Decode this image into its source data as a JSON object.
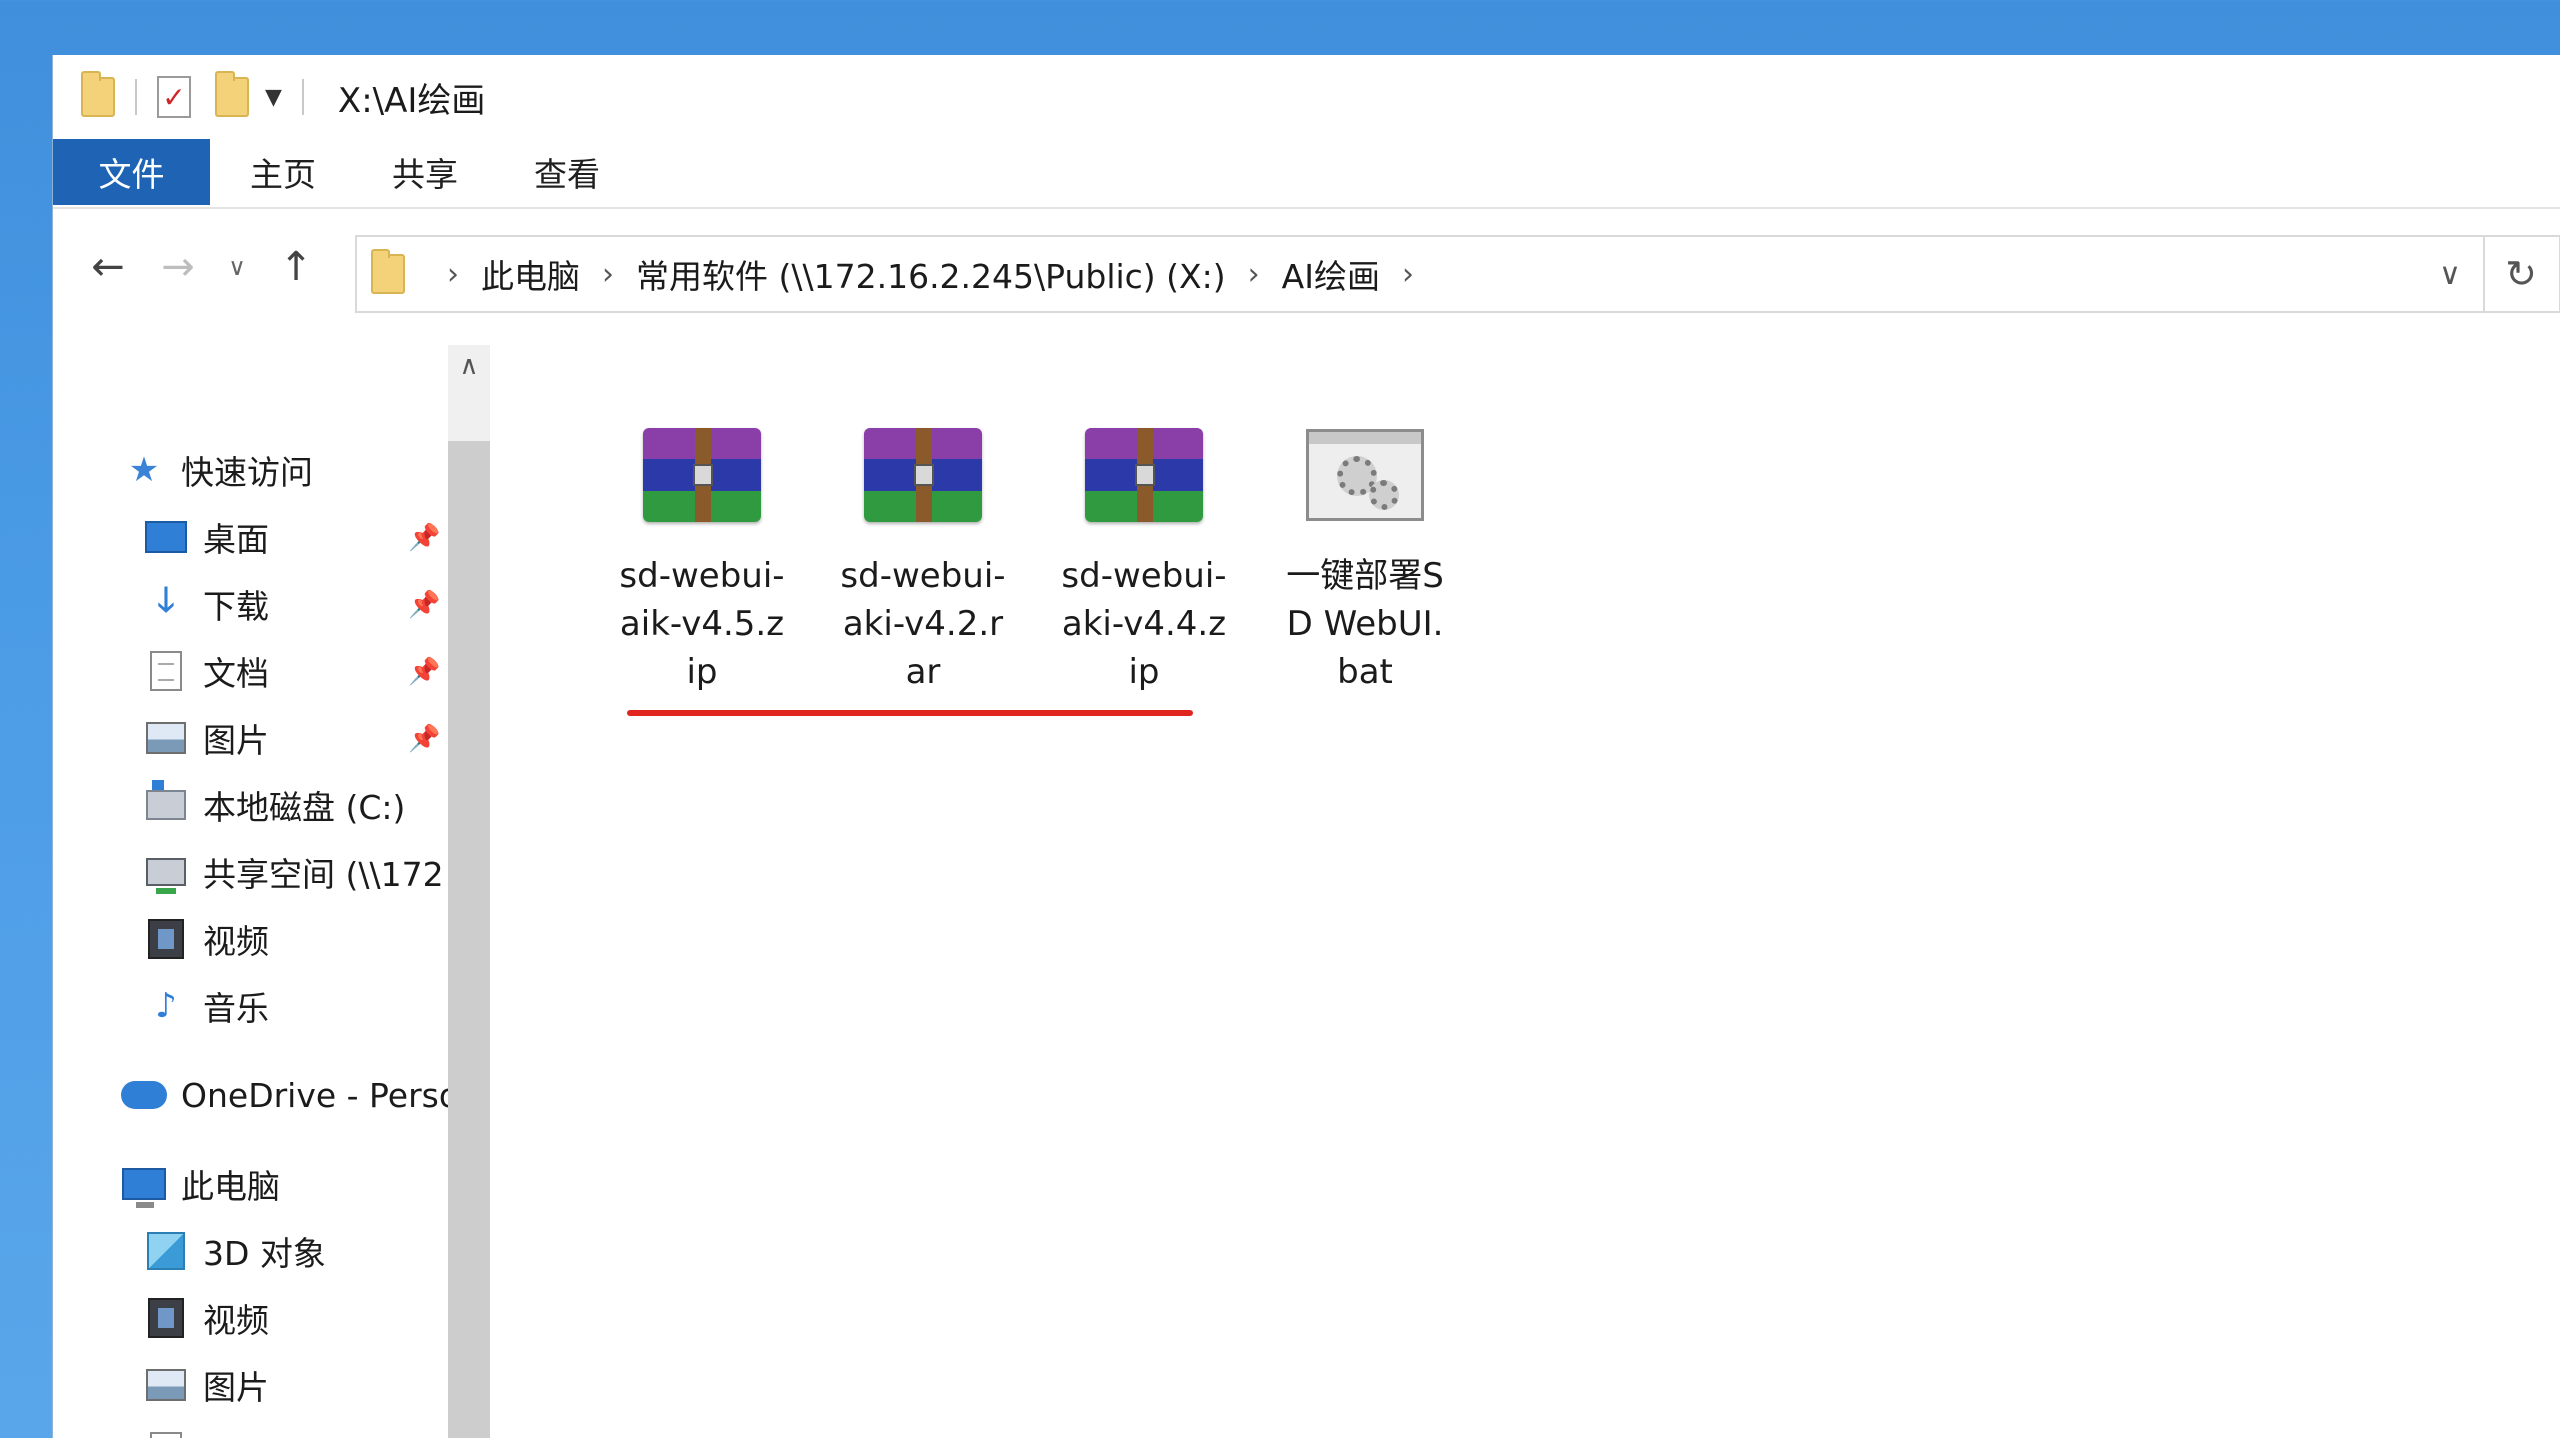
{
  "window": {
    "title": "X:\\AI绘画"
  },
  "ribbon": {
    "tabs": [
      {
        "label": "文件",
        "active": true
      },
      {
        "label": "主页"
      },
      {
        "label": "共享"
      },
      {
        "label": "查看"
      }
    ]
  },
  "nav": {
    "back": "←",
    "forward": "→",
    "recent": "∨",
    "up": "↑"
  },
  "address": {
    "crumbs": [
      "此电脑",
      "常用软件 (\\\\172.16.2.245\\Public) (X:)",
      "AI绘画"
    ],
    "separator": "›",
    "dropdown": "∨",
    "refresh": "↻"
  },
  "sidebar": {
    "quick_access": "快速访问",
    "quick_items": [
      {
        "label": "桌面",
        "icon": "desktop-icon",
        "pinned": true
      },
      {
        "label": "下载",
        "icon": "download-icon",
        "pinned": true
      },
      {
        "label": "文档",
        "icon": "document-icon",
        "pinned": true
      },
      {
        "label": "图片",
        "icon": "pictures-icon",
        "pinned": true
      },
      {
        "label": "本地磁盘 (C:)",
        "icon": "drive-icon"
      },
      {
        "label": "共享空间 (\\\\172",
        "icon": "network-drive-icon"
      },
      {
        "label": "视频",
        "icon": "video-icon"
      },
      {
        "label": "音乐",
        "icon": "music-icon"
      }
    ],
    "onedrive": "OneDrive - Perso",
    "this_pc": "此电脑",
    "pc_items": [
      {
        "label": "3D 对象",
        "icon": "3d-objects-icon"
      },
      {
        "label": "视频",
        "icon": "video-icon"
      },
      {
        "label": "图片",
        "icon": "pictures-icon"
      },
      {
        "label": "文档",
        "icon": "document-icon"
      }
    ],
    "scroll_up": "∧"
  },
  "files": [
    {
      "name": "sd-webui-aik-v4.5.zip",
      "type": "archive"
    },
    {
      "name": "sd-webui-aki-v4.2.rar",
      "type": "archive"
    },
    {
      "name": "sd-webui-aki-v4.4.zip",
      "type": "archive"
    },
    {
      "name": "一键部署SD WebUI.bat",
      "type": "batch"
    }
  ],
  "colors": {
    "file_tab": "#1f63b5",
    "annotation_underline": "#e0271f",
    "desktop_bg": "#4a9be6"
  }
}
